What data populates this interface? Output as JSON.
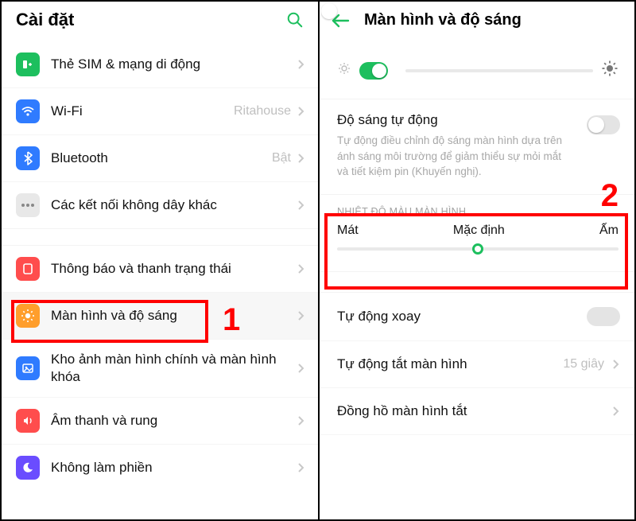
{
  "left": {
    "title": "Cài đặt",
    "items": [
      {
        "label": "Thẻ SIM & mạng di động",
        "value": ""
      },
      {
        "label": "Wi-Fi",
        "value": "Ritahouse"
      },
      {
        "label": "Bluetooth",
        "value": "Bật"
      },
      {
        "label": "Các kết nối không dây khác",
        "value": ""
      }
    ],
    "items2": [
      {
        "label": "Thông báo và thanh trạng thái"
      },
      {
        "label": "Màn hình và độ sáng"
      },
      {
        "label": "Kho ảnh màn hình chính và màn hình khóa"
      },
      {
        "label": "Âm thanh và rung"
      },
      {
        "label": "Không làm phiền"
      }
    ]
  },
  "right": {
    "title": "Màn hình và độ sáng",
    "auto_brightness": {
      "title": "Độ sáng tự động",
      "desc": "Tự động điều chỉnh độ sáng màn hình dựa trên ánh sáng môi trường để giảm thiểu sự mỏi mắt và tiết kiệm pin (Khuyến nghị)."
    },
    "temp_section": "NHIỆT ĐỘ MÀU MÀN HÌNH",
    "temp": {
      "cool": "Mát",
      "default": "Mặc định",
      "warm": "Ấm"
    },
    "auto_rotate": "Tự động xoay",
    "screen_off": {
      "label": "Tự động tắt màn hình",
      "value": "15 giây"
    },
    "clock_off": "Đồng hồ màn hình tắt"
  },
  "annotations": {
    "one": "1",
    "two": "2"
  }
}
